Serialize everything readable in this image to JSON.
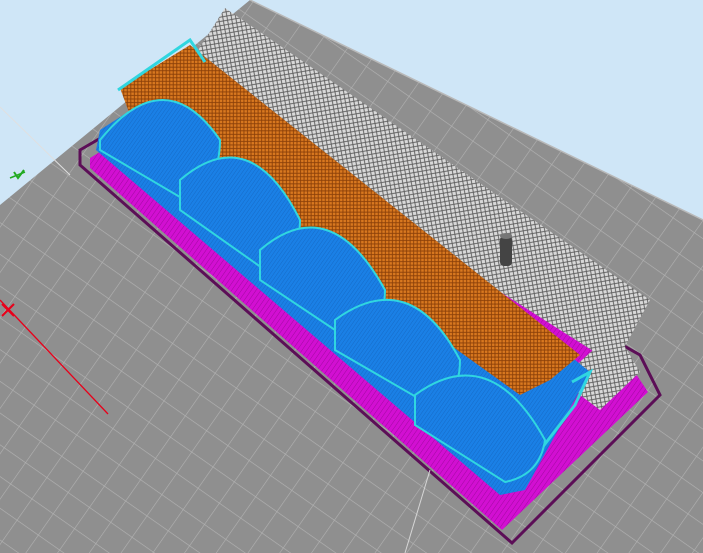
{
  "app": {
    "view": "3d-print-layer-preview"
  },
  "colors": {
    "background": "#cfe6f7",
    "build_plate": "#8f8f8f",
    "grid_line": "#a8a8a8",
    "skirt": "#5c0e57",
    "brim": "#d20fd2",
    "perimeter": "#1a80e6",
    "infill": "#d9781f",
    "top_skin_edge": "#30d6e0",
    "support": "#ececec",
    "axis_x": "#e8001a",
    "axis_y": "#22aa22"
  },
  "legend": {
    "skirt": "skirt",
    "brim": "brim",
    "walls": "walls",
    "infill": "infill",
    "support": "support"
  }
}
